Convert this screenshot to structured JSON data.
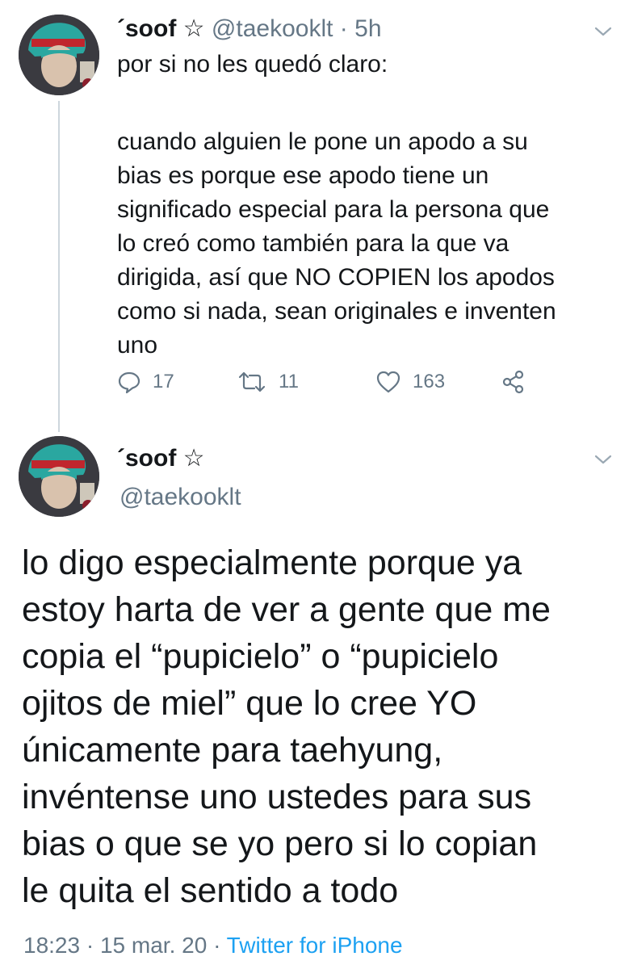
{
  "tweet1": {
    "display_name": "´soof",
    "star": "☆",
    "handle": "@taekooklt",
    "separator": "·",
    "time": "5h",
    "lines": [
      "por si no les quedó claro:",
      "",
      "cuando alguien le pone un apodo a su",
      "bias es porque ese apodo tiene un",
      "significado especial para la persona que",
      "lo creó como también para la que va",
      "dirigida, así que NO COPIEN los apodos",
      "como si nada, sean originales e inventen",
      "uno"
    ],
    "actions": {
      "reply_count": "17",
      "retweet_count": "11",
      "like_count": "163"
    }
  },
  "tweet2": {
    "display_name": "´soof",
    "star": "☆",
    "handle": "@taekooklt",
    "lines": [
      "lo digo especialmente porque ya",
      "estoy harta de ver a gente que me",
      "copia el “pupicielo” o “pupicielo",
      "ojitos de miel” que lo cree YO",
      "únicamente para taehyung,",
      "invéntense uno ustedes para sus",
      "bias o que se yo pero si lo copian",
      "le quita el sentido a todo"
    ],
    "meta": {
      "time": "18:23",
      "sep1": "·",
      "date": "15 mar. 20",
      "sep2": "·",
      "source": "Twitter for iPhone"
    }
  },
  "icons": {
    "reply": "reply-icon",
    "retweet": "retweet-icon",
    "like": "heart-icon",
    "share": "share-icon",
    "chevron": "chevron-down-icon"
  },
  "colors": {
    "text": "#14171a",
    "muted": "#657786",
    "link": "#1da1f2",
    "thread_line": "#cdd6dd"
  }
}
